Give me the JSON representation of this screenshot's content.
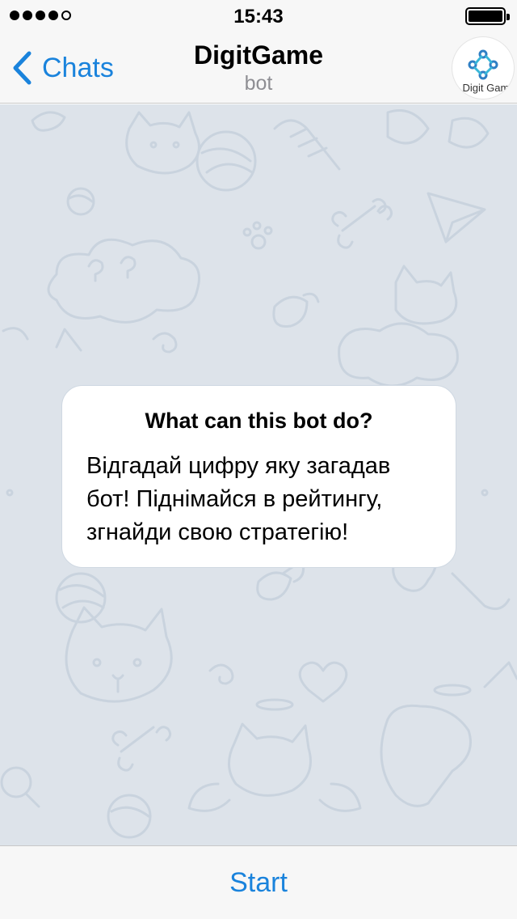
{
  "status_bar": {
    "time": "15:43",
    "signal_dots_filled": 4,
    "signal_dots_total": 5,
    "battery_icon": "battery-icon",
    "battery_level": 1.0
  },
  "nav": {
    "back_label": "Chats",
    "back_icon": "chevron-left-icon",
    "title": "DigitGame",
    "subtitle": "bot",
    "avatar_text": "Digit Game"
  },
  "info_card": {
    "title": "What can this bot do?",
    "lines": [
      "Відгадай цифру яку загадав",
      "бот! Піднімайся в рейтингу,",
      "згнайди свою стратегію!"
    ]
  },
  "bottom": {
    "start_label": "Start"
  },
  "colors": {
    "accent": "#1a83dc",
    "chat_background": "#dde3ea",
    "doodle_stroke": "#c9d3de",
    "bar_background": "#f7f7f7",
    "avatar_logo_blue": "#2f7fc4",
    "avatar_logo_cyan": "#38b6d8"
  }
}
